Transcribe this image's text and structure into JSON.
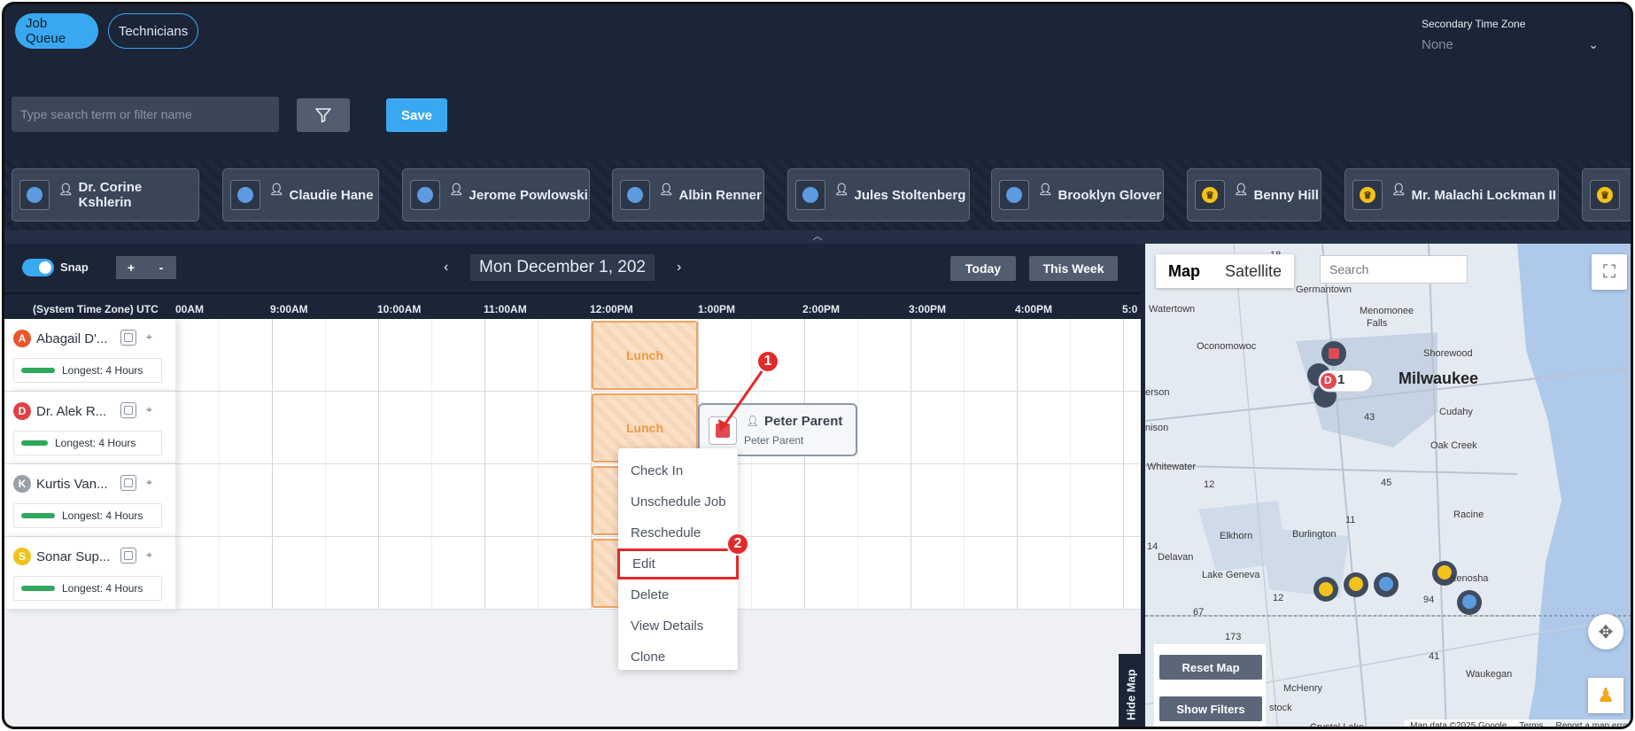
{
  "tabs": [
    {
      "label": "Job Queue"
    },
    {
      "label": "Technicians"
    }
  ],
  "secondary_tz": {
    "label": "Secondary Time Zone",
    "value": "None"
  },
  "search": {
    "placeholder": "Type search term or filter name"
  },
  "save_label": "Save",
  "technicians": [
    {
      "name": "Dr. Corine Kshlerin",
      "icon": "blue-dot"
    },
    {
      "name": "Claudie Hane",
      "icon": "blue-dot"
    },
    {
      "name": "Jerome Powlowski",
      "icon": "blue-dot"
    },
    {
      "name": "Albin Renner",
      "icon": "blue-dot"
    },
    {
      "name": "Jules Stoltenberg",
      "icon": "blue-dot"
    },
    {
      "name": "Brooklyn Glover",
      "icon": "blue-dot"
    },
    {
      "name": "Benny Hill",
      "icon": "crown"
    },
    {
      "name": "Mr. Malachi Lockman II",
      "icon": "crown"
    }
  ],
  "toolbar": {
    "snap_label": "Snap",
    "zoom_in": "+",
    "zoom_out": "-",
    "prev": "‹",
    "next": "›",
    "date": "Mon December 1, 202",
    "today": "Today",
    "this_week": "This Week"
  },
  "time_header": {
    "tz_label": "(System Time Zone) UTC",
    "ticks": [
      "00AM",
      "9:00AM",
      "10:00AM",
      "11:00AM",
      "12:00PM",
      "1:00PM",
      "2:00PM",
      "3:00PM",
      "4:00PM",
      "5:0"
    ]
  },
  "rows": [
    {
      "initial": "A",
      "color": "#e8562a",
      "name": "Abagail D'...",
      "longest_label": "Longest:",
      "longest_value": "4 Hours"
    },
    {
      "initial": "D",
      "color": "#e04046",
      "name": "Dr. Alek R...",
      "longest_label": "Longest:",
      "longest_value": "4 Hours"
    },
    {
      "initial": "K",
      "color": "#9aa0a8",
      "name": "Kurtis Van...",
      "longest_label": "Longest:",
      "longest_value": "4 Hours"
    },
    {
      "initial": "S",
      "color": "#f2c21b",
      "name": "Sonar Sup...",
      "longest_label": "Longest:",
      "longest_value": "4 Hours"
    }
  ],
  "lunch_label": "Lunch",
  "job": {
    "title": "Peter Parent",
    "subtitle": "Peter Parent"
  },
  "context_menu": [
    {
      "label": "Check In"
    },
    {
      "label": "Unschedule Job"
    },
    {
      "label": "Reschedule"
    },
    {
      "label": "Edit"
    },
    {
      "label": "Delete"
    },
    {
      "label": "View Details"
    },
    {
      "label": "Clone"
    }
  ],
  "annotations": [
    "1",
    "2"
  ],
  "hide_map": "Hide Map",
  "map": {
    "type_map": "Map",
    "type_satellite": "Satellite",
    "search_placeholder": "Search",
    "reset": "Reset Map",
    "filters": "Show Filters",
    "cluster_count": "1",
    "cluster_badge": "D",
    "attribution": [
      "Map data ©2025 Google",
      "Terms",
      "Report a map error"
    ],
    "places": [
      {
        "name": "Germantown"
      },
      {
        "name": "Watertown"
      },
      {
        "name": "Menomonee"
      },
      {
        "name": "Falls"
      },
      {
        "name": "Oconomowoc"
      },
      {
        "name": "Shorewood"
      },
      {
        "name": "Milwaukee"
      },
      {
        "name": "erson"
      },
      {
        "name": "Cudahy"
      },
      {
        "name": "nison"
      },
      {
        "name": "Oak Creek"
      },
      {
        "name": "Whitewater"
      },
      {
        "name": "Racine"
      },
      {
        "name": "Elkhorn"
      },
      {
        "name": "Burlington"
      },
      {
        "name": "Delavan"
      },
      {
        "name": "Lake Geneva"
      },
      {
        "name": "Kenosha"
      },
      {
        "name": "Waukegan"
      },
      {
        "name": "McHenry"
      },
      {
        "name": "stock"
      },
      {
        "name": "Crystal Lake"
      }
    ],
    "roads": [
      "18",
      "43",
      "12",
      "45",
      "11",
      "14",
      "12",
      "94",
      "67",
      "173",
      "41"
    ]
  },
  "colors": {
    "accent": "#39a8f0",
    "dark_bg": "#1b2537",
    "lunch_border": "#f3a25c",
    "annotation": "#e22a2a"
  }
}
